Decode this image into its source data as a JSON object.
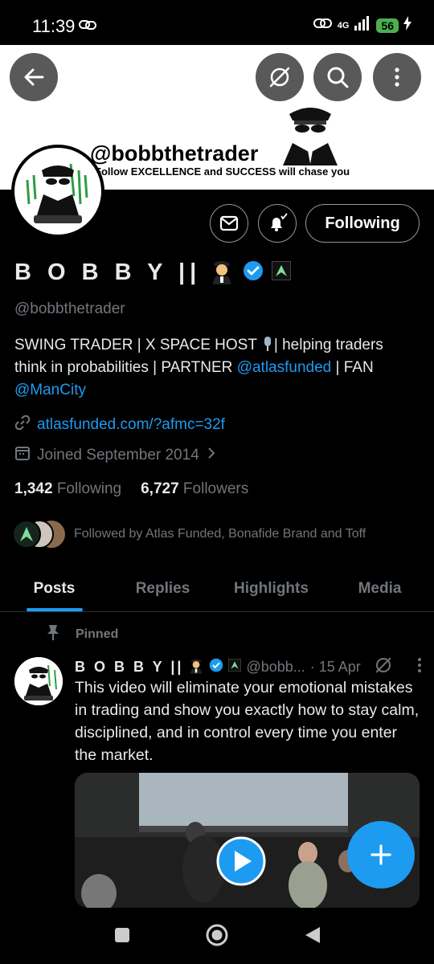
{
  "status_bar": {
    "time": "11:39",
    "network": "4G",
    "battery": "56"
  },
  "banner": {
    "handle": "@bobbthetrader",
    "motto": "Follow EXCELLENCE and SUCCESS will chase you"
  },
  "profile": {
    "display_name": "B O B B Y ||",
    "handle": "@bobbthetrader",
    "bio_part1": "SWING TRADER | X SPACE HOST ",
    "bio_part2": "| helping traders think in probabilities | PARTNER ",
    "bio_mention1": "@atlasfunded",
    "bio_part3": " | FAN ",
    "bio_mention2": "@ManCity",
    "website": "atlasfunded.com/?afmc=32f",
    "joined": "Joined September 2014",
    "following_count": "1,342",
    "following_label": "Following",
    "followers_count": "6,727",
    "followers_label": "Followers",
    "followed_by": "Followed by Atlas Funded, Bonafide Brand and Toff"
  },
  "actions": {
    "following_button": "Following"
  },
  "tabs": [
    {
      "label": "Posts",
      "active": true
    },
    {
      "label": "Replies",
      "active": false
    },
    {
      "label": "Highlights",
      "active": false
    },
    {
      "label": "Media",
      "active": false
    }
  ],
  "post": {
    "pinned_label": "Pinned",
    "name": "B O B B Y ||",
    "handle": "@bobb...",
    "date": "· 15 Apr",
    "text": "This video will eliminate your emotional mistakes in trading and show you exactly how to stay calm, disciplined, and in control every time you enter the market."
  },
  "colors": {
    "accent": "#1d9bf0",
    "background": "#000000",
    "muted": "#71767b"
  }
}
